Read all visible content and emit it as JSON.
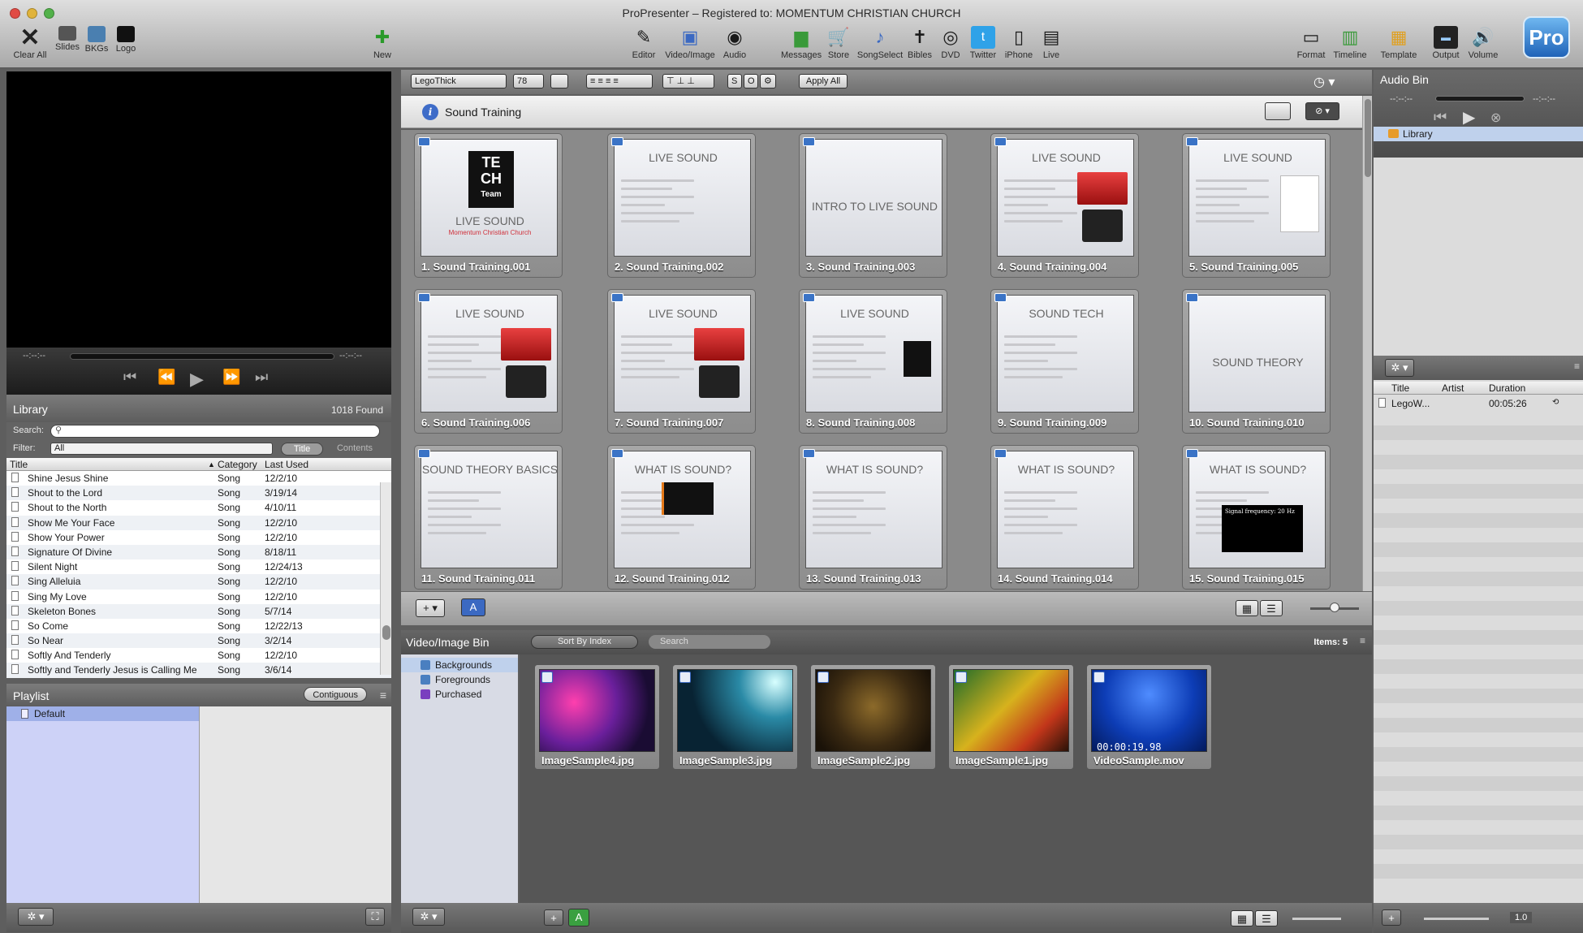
{
  "window": {
    "title": "ProPresenter – Registered to: MOMENTUM CHRISTIAN CHURCH"
  },
  "toolbar": {
    "left": [
      {
        "label": "Clear All",
        "icon": "clear-all-icon"
      },
      {
        "label": "Slides",
        "icon": "slides-icon"
      },
      {
        "label": "BKGs",
        "icon": "bkgs-icon"
      },
      {
        "label": "Logo",
        "icon": "logo-icon"
      }
    ],
    "new_label": "New",
    "center": [
      {
        "label": "Editor",
        "icon": "editor-icon"
      },
      {
        "label": "Video/Image",
        "icon": "video-image-icon"
      },
      {
        "label": "Audio",
        "icon": "audio-icon"
      },
      {
        "label": "Messages",
        "icon": "messages-icon"
      },
      {
        "label": "Store",
        "icon": "store-icon"
      },
      {
        "label": "SongSelect",
        "icon": "songselect-icon"
      },
      {
        "label": "Bibles",
        "icon": "bibles-icon"
      },
      {
        "label": "DVD",
        "icon": "dvd-icon"
      },
      {
        "label": "Twitter",
        "icon": "twitter-icon"
      },
      {
        "label": "iPhone",
        "icon": "iphone-icon"
      },
      {
        "label": "Live",
        "icon": "live-icon"
      }
    ],
    "right": [
      {
        "label": "Format",
        "icon": "format-icon"
      },
      {
        "label": "Timeline",
        "icon": "timeline-icon"
      },
      {
        "label": "Template",
        "icon": "template-icon"
      },
      {
        "label": "Output",
        "icon": "output-icon"
      },
      {
        "label": "Volume",
        "icon": "volume-icon"
      }
    ],
    "logo_text": "Pro"
  },
  "preview": {
    "time_left": "--:--:--",
    "time_right": "--:--:--"
  },
  "library": {
    "title": "Library",
    "found": "1018 Found",
    "search_label": "Search:",
    "search_value": "",
    "filter_label": "Filter:",
    "filter_value": "All",
    "title_btn": "Title",
    "contents_btn": "Contents",
    "columns": [
      "Title",
      "Category",
      "Last Used"
    ],
    "rows": [
      {
        "title": "Shine Jesus Shine",
        "category": "Song",
        "last_used": "12/2/10"
      },
      {
        "title": "Shout to the Lord",
        "category": "Song",
        "last_used": "3/19/14"
      },
      {
        "title": "Shout to the North",
        "category": "Song",
        "last_used": "4/10/11"
      },
      {
        "title": "Show Me Your Face",
        "category": "Song",
        "last_used": "12/2/10"
      },
      {
        "title": "Show Your Power",
        "category": "Song",
        "last_used": "12/2/10"
      },
      {
        "title": "Signature Of Divine",
        "category": "Song",
        "last_used": "8/18/11"
      },
      {
        "title": "Silent Night",
        "category": "Song",
        "last_used": "12/24/13"
      },
      {
        "title": "Sing Alleluia",
        "category": "Song",
        "last_used": "12/2/10"
      },
      {
        "title": "Sing My Love",
        "category": "Song",
        "last_used": "12/2/10"
      },
      {
        "title": "Skeleton Bones",
        "category": "Song",
        "last_used": "5/7/14"
      },
      {
        "title": "So Come",
        "category": "Song",
        "last_used": "12/22/13"
      },
      {
        "title": "So Near",
        "category": "Song",
        "last_used": "3/2/14"
      },
      {
        "title": "Softly And Tenderly",
        "category": "Song",
        "last_used": "12/2/10"
      },
      {
        "title": "Softly and Tenderly Jesus is Calling Me",
        "category": "Song",
        "last_used": "3/6/14"
      }
    ]
  },
  "playlist": {
    "title": "Playlist",
    "contiguous_btn": "Contiguous",
    "items": [
      "Default"
    ]
  },
  "center_toolbar": {
    "font": "LegoThick",
    "size": "78",
    "apply_all": "Apply All",
    "s_btn": "S",
    "o_btn": "O"
  },
  "document": {
    "title": "Sound Training"
  },
  "slides": [
    {
      "label": "1.  Sound Training.001",
      "title": "LIVE SOUND",
      "sub": "Momentum Christian Church"
    },
    {
      "label": "2. Sound Training.002",
      "title": "LIVE SOUND"
    },
    {
      "label": "3. Sound Training.003",
      "title": "INTRO TO LIVE SOUND"
    },
    {
      "label": "4. Sound Training.004",
      "title": "LIVE SOUND"
    },
    {
      "label": "5. Sound Training.005",
      "title": "LIVE SOUND"
    },
    {
      "label": "6. Sound Training.006",
      "title": "LIVE SOUND"
    },
    {
      "label": "7. Sound Training.007",
      "title": "LIVE SOUND"
    },
    {
      "label": "8. Sound Training.008",
      "title": "LIVE SOUND"
    },
    {
      "label": "9. Sound Training.009",
      "title": "SOUND TECH"
    },
    {
      "label": "10. Sound Training.010",
      "title": "SOUND THEORY"
    },
    {
      "label": "11. Sound Training.011",
      "title": "SOUND THEORY BASICS"
    },
    {
      "label": "12. Sound Training.012",
      "title": "WHAT IS SOUND?"
    },
    {
      "label": "13. Sound Training.013",
      "title": "WHAT IS SOUND?"
    },
    {
      "label": "14. Sound Training.014",
      "title": "WHAT IS SOUND?"
    },
    {
      "label": "15. Sound Training.015",
      "title": "WHAT IS SOUND?",
      "inner": "Signal frequency: 20 Hz"
    }
  ],
  "slide_logo_text": [
    "TE",
    "CH",
    "Team"
  ],
  "video_bin": {
    "title": "Video/Image Bin",
    "sort": "Sort By Index",
    "search_placeholder": "Search",
    "items_label": "Items: 5",
    "folders": [
      "Backgrounds",
      "Foregrounds",
      "Purchased"
    ],
    "thumbs": [
      {
        "label": "ImageSample4.jpg",
        "bg": "radial-gradient(circle at 30% 40%,#ff3fae,#6a1f9b 45%,#1a0c33 80%)"
      },
      {
        "label": "ImageSample3.jpg",
        "bg": "radial-gradient(circle at 85% 15%,#d8ffff,#2a8aa6 30%,#082333 70%)"
      },
      {
        "label": "ImageSample2.jpg",
        "bg": "radial-gradient(circle at 50% 45%,#8c6a2a,#3b2a12 55%,#1a1208 90%)"
      },
      {
        "label": "ImageSample1.jpg",
        "bg": "linear-gradient(135deg,#1f6b2a,#d7b21d 45%,#c2361a 75%,#2a1208)"
      },
      {
        "label": "VideoSample.mov",
        "bg": "radial-gradient(circle at 50% 30%,#4f8cff,#0d3db6 55%,#031a5c)",
        "time": "00:00:19.98"
      }
    ]
  },
  "audio_bin": {
    "title": "Audio Bin",
    "time_left": "--:--:--",
    "time_right": "--:--:--",
    "library_label": "Library",
    "columns": [
      "Title",
      "Artist",
      "Duration"
    ],
    "rows": [
      {
        "title": "LegoW...",
        "artist": "",
        "duration": "00:05:26"
      }
    ],
    "zoom": "1.0"
  }
}
